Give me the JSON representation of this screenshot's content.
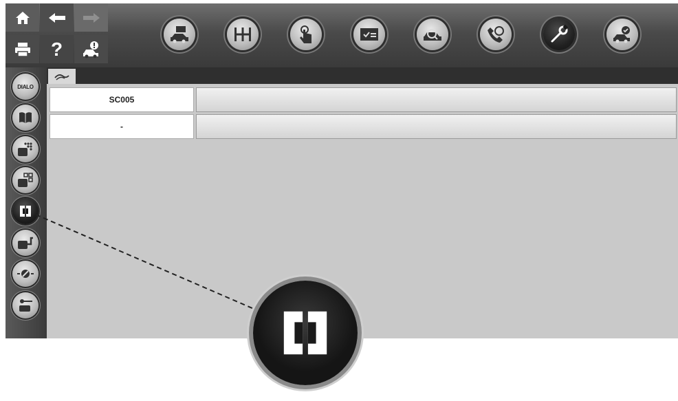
{
  "toolbar": {
    "help_label": "?",
    "buttons": [
      {
        "icon": "vehicle-id-icon"
      },
      {
        "icon": "gearbox-icon"
      },
      {
        "icon": "touch-icon"
      },
      {
        "icon": "checklist-icon"
      },
      {
        "icon": "diagnosis-icon"
      },
      {
        "icon": "hotline-icon"
      },
      {
        "icon": "wrench-icon",
        "active": true
      },
      {
        "icon": "car-check-icon"
      }
    ]
  },
  "sidebar": {
    "dialo_label": "DIALO",
    "items": [
      {
        "icon": "dialo-icon"
      },
      {
        "icon": "book-icon"
      },
      {
        "icon": "ecu-dots-icon"
      },
      {
        "icon": "ecu-grid-icon"
      },
      {
        "icon": "connector-icon",
        "active": true
      },
      {
        "icon": "ecu-switch-icon"
      },
      {
        "icon": "sensor-icon"
      },
      {
        "icon": "actuator-icon"
      }
    ]
  },
  "table": {
    "rows": [
      {
        "label": "SC005",
        "value": ""
      },
      {
        "label": "-",
        "value": ""
      }
    ]
  },
  "callout": {
    "icon": "connector-icon"
  }
}
